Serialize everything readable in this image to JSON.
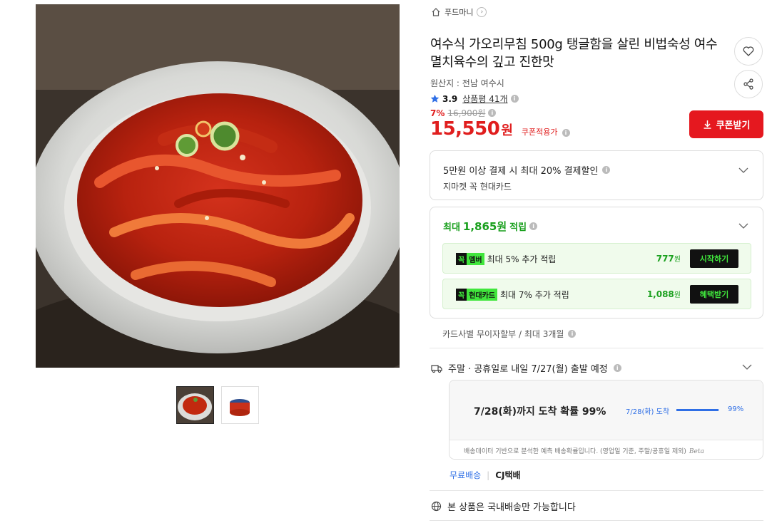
{
  "shop": {
    "name": "푸드마니",
    "home_icon": "home-icon",
    "arrow": "›"
  },
  "product": {
    "title": "여수식 가오리무침 500g 탱글함을 살린 비법숙성 여수멸치육수의 깊고 진한맛",
    "origin": "원산지 : 전남 여수시",
    "rating": "3.9",
    "review_label": "상품평 41개",
    "discount_rate": "7%",
    "original_price": "16,900원",
    "price": "15,550",
    "price_unit": "원",
    "coupon_note": "쿠폰적용가",
    "coupon_button": "쿠폰받기",
    "info": "i"
  },
  "card_discount": {
    "line1": "5만원 이상 결제 시 최대 20% 결제할인",
    "line2": "지마켓 꼭 현대카드"
  },
  "points": {
    "prefix": "최대",
    "amount": "1,865원",
    "suffix": "적립",
    "rows": [
      {
        "badge_k": "꼭",
        "badge_b": "멤버",
        "desc": "최대 5% 추가 적립",
        "amount": "777",
        "unit": "원",
        "action": "시작하기"
      },
      {
        "badge_k": "꼭",
        "badge_b": "현대카드",
        "desc": "최대 7% 추가 적립",
        "amount": "1,088",
        "unit": "원",
        "action": "혜택받기"
      }
    ]
  },
  "installment": "카드사별 무이자할부 / 최대 3개월",
  "shipping": {
    "schedule": "주말 · 공휴일로 내일 7/27(월) 출발 예정",
    "prob_title": "7/28(화)까지 도착 확률 99%",
    "bar_label": "7/28(화) 도착",
    "bar_value": 0.99,
    "bar_pct": "99%",
    "note": "배송데이터 기반으로 분석한 예측 배송확률입니다. (영업일 기준, 주말/공휴일 제외)",
    "beta": "Beta",
    "free": "무료배송",
    "sep": "|",
    "carrier": "CJ택배",
    "domestic": "본 상품은 국내배송만 가능합니다"
  },
  "colors": {
    "accent_red": "#e5181f",
    "point_green": "#1aa01e",
    "badge_green": "#40e63c",
    "link_blue": "#2f6fe6"
  }
}
